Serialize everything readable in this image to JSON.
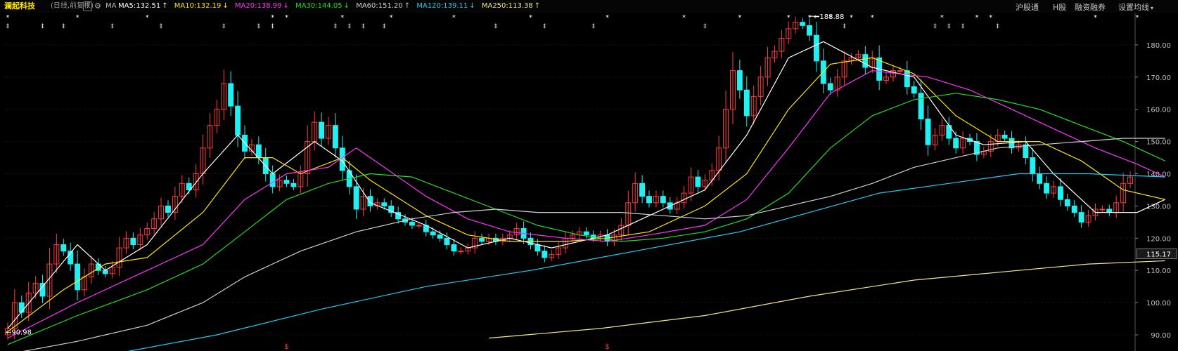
{
  "header": {
    "stock_name": "澜起科技",
    "period": "(日线,前复权)",
    "help": "?",
    "ma_label": "MA",
    "ma_items": [
      {
        "label": "MA5:132.51",
        "arrow": "↑",
        "color": "#ffffff"
      },
      {
        "label": "MA10:132.19",
        "arrow": "↓",
        "color": "#ffe600"
      },
      {
        "label": "MA20:138.99",
        "arrow": "↓",
        "color": "#ff33ff"
      },
      {
        "label": "MA30:144.05",
        "arrow": "↓",
        "color": "#22dd22"
      },
      {
        "label": "MA60:151.20",
        "arrow": "↑",
        "color": "#d0d0d0"
      },
      {
        "label": "MA120:139.11",
        "arrow": "↓",
        "color": "#22ccee"
      },
      {
        "label": "MA250:113.38",
        "arrow": "↑",
        "color": "#f0e68c"
      }
    ],
    "menu": [
      "沪股通",
      "H股",
      "融资融券",
      "设置均线"
    ]
  },
  "colors": {
    "up": "#ff3b3b",
    "down": "#22f0f0",
    "grid": "#3a1a1a",
    "axis_text": "#c0c0c0",
    "price_tag_bg": "#1a1a1a",
    "marker": "#ffffff",
    "dollar_marker": "#ff3b3b"
  },
  "chart_data": {
    "type": "candlestick",
    "ylim": [
      85,
      190
    ],
    "yticks": [
      90,
      100,
      110,
      120,
      130,
      140,
      150,
      160,
      170,
      180
    ],
    "ytick_labels": [
      "90.00",
      "100.00",
      "110.00",
      "120.00",
      "130.00",
      "140.00",
      "150.00",
      "160.00",
      "170.00",
      "180.00"
    ],
    "current_price": 115.17,
    "current_price_label": "115.17",
    "high_annotation": {
      "value": 188.88,
      "label": "188.88",
      "index": 115
    },
    "low_annotation": {
      "value": 90.98,
      "label": "90.98",
      "index": 0
    },
    "dollar_markers": [
      {
        "index": 40,
        "label": "$"
      },
      {
        "index": 86,
        "label": "$"
      }
    ],
    "star_markers_row1": [
      0,
      10,
      20,
      38,
      40,
      48,
      55,
      64,
      75,
      86,
      97,
      105,
      112,
      115,
      118,
      121,
      124,
      134,
      139,
      141,
      156,
      162
    ],
    "star_markers_row2": [
      0,
      5,
      8,
      15,
      22,
      31,
      36,
      38,
      47,
      49,
      51,
      54,
      70,
      77,
      84,
      100,
      120,
      133,
      135,
      137,
      142
    ],
    "closes": [
      92,
      100,
      97,
      103,
      106,
      102,
      112,
      118,
      116,
      112,
      104,
      108,
      112,
      110,
      109,
      111,
      117,
      120,
      118,
      121,
      123,
      126,
      130,
      128,
      133,
      137,
      135,
      140,
      148,
      155,
      160,
      168,
      161,
      152,
      147,
      149,
      145,
      140,
      136,
      138,
      137,
      136,
      140,
      150,
      156,
      151,
      155,
      148,
      141,
      136,
      129,
      133,
      130,
      131,
      130,
      128,
      126,
      125,
      124,
      124,
      122,
      121,
      120,
      118,
      116,
      116,
      117,
      120,
      119,
      120,
      119,
      120,
      121,
      123,
      120,
      118,
      116,
      114,
      115,
      117,
      120,
      121,
      122,
      121,
      120,
      121,
      119,
      121,
      124,
      131,
      137,
      133,
      131,
      133,
      131,
      129,
      131,
      134,
      139,
      136,
      138,
      141,
      148,
      160,
      172,
      166,
      158,
      164,
      170,
      176,
      178,
      182,
      185,
      187,
      186,
      183,
      175,
      168,
      166,
      170,
      175,
      176,
      177,
      173,
      176,
      169,
      170,
      172,
      172,
      167,
      165,
      157,
      149,
      152,
      155,
      151,
      148,
      151,
      150,
      146,
      147,
      150,
      152,
      151,
      148,
      149,
      145,
      140,
      137,
      134,
      136,
      132,
      130,
      128,
      125,
      127,
      129,
      129,
      128,
      131,
      137,
      139
    ],
    "series": [
      {
        "name": "MA5",
        "color": "#ffffff",
        "values": [
          [
            0,
            92
          ],
          [
            10,
            118
          ],
          [
            14,
            110
          ],
          [
            20,
            118
          ],
          [
            28,
            140
          ],
          [
            33,
            152
          ],
          [
            38,
            140
          ],
          [
            44,
            150
          ],
          [
            48,
            144
          ],
          [
            52,
            131
          ],
          [
            60,
            124
          ],
          [
            66,
            117
          ],
          [
            72,
            120
          ],
          [
            78,
            117
          ],
          [
            86,
            121
          ],
          [
            92,
            127
          ],
          [
            100,
            135
          ],
          [
            106,
            152
          ],
          [
            112,
            176
          ],
          [
            117,
            181
          ],
          [
            124,
            173
          ],
          [
            130,
            170
          ],
          [
            136,
            152
          ],
          [
            140,
            149
          ],
          [
            146,
            150
          ],
          [
            150,
            140
          ],
          [
            156,
            128
          ],
          [
            162,
            128
          ],
          [
            166,
            132
          ]
        ]
      },
      {
        "name": "MA10",
        "color": "#ffe600",
        "values": [
          [
            0,
            91
          ],
          [
            8,
            104
          ],
          [
            14,
            112
          ],
          [
            20,
            114
          ],
          [
            28,
            128
          ],
          [
            34,
            145
          ],
          [
            38,
            145
          ],
          [
            42,
            140
          ],
          [
            48,
            145
          ],
          [
            52,
            138
          ],
          [
            60,
            127
          ],
          [
            66,
            121
          ],
          [
            72,
            119
          ],
          [
            80,
            119
          ],
          [
            86,
            120
          ],
          [
            92,
            122
          ],
          [
            100,
            130
          ],
          [
            106,
            140
          ],
          [
            112,
            160
          ],
          [
            118,
            174
          ],
          [
            124,
            176
          ],
          [
            130,
            171
          ],
          [
            136,
            158
          ],
          [
            142,
            150
          ],
          [
            148,
            150
          ],
          [
            154,
            144
          ],
          [
            160,
            135
          ],
          [
            166,
            132
          ]
        ]
      },
      {
        "name": "MA20",
        "color": "#ff33ff",
        "values": [
          [
            0,
            89
          ],
          [
            10,
            100
          ],
          [
            20,
            110
          ],
          [
            28,
            118
          ],
          [
            34,
            132
          ],
          [
            40,
            140
          ],
          [
            46,
            142
          ],
          [
            50,
            148
          ],
          [
            54,
            142
          ],
          [
            60,
            133
          ],
          [
            66,
            126
          ],
          [
            72,
            122
          ],
          [
            80,
            120
          ],
          [
            86,
            119
          ],
          [
            92,
            121
          ],
          [
            100,
            124
          ],
          [
            106,
            132
          ],
          [
            112,
            148
          ],
          [
            118,
            165
          ],
          [
            124,
            172
          ],
          [
            132,
            170
          ],
          [
            138,
            166
          ],
          [
            144,
            160
          ],
          [
            150,
            154
          ],
          [
            156,
            148
          ],
          [
            162,
            143
          ],
          [
            166,
            139
          ]
        ]
      },
      {
        "name": "MA30",
        "color": "#22dd22",
        "values": [
          [
            0,
            87
          ],
          [
            10,
            96
          ],
          [
            20,
            104
          ],
          [
            28,
            112
          ],
          [
            34,
            122
          ],
          [
            40,
            132
          ],
          [
            46,
            137
          ],
          [
            52,
            140
          ],
          [
            58,
            139
          ],
          [
            64,
            134
          ],
          [
            70,
            129
          ],
          [
            76,
            124
          ],
          [
            82,
            121
          ],
          [
            88,
            119
          ],
          [
            94,
            120
          ],
          [
            100,
            122
          ],
          [
            106,
            126
          ],
          [
            112,
            134
          ],
          [
            118,
            148
          ],
          [
            124,
            158
          ],
          [
            130,
            163
          ],
          [
            136,
            165
          ],
          [
            142,
            163
          ],
          [
            148,
            160
          ],
          [
            154,
            155
          ],
          [
            160,
            150
          ],
          [
            166,
            144
          ]
        ]
      },
      {
        "name": "MA60",
        "color": "#d0d0d0",
        "values": [
          [
            0,
            84
          ],
          [
            10,
            88
          ],
          [
            20,
            93
          ],
          [
            28,
            100
          ],
          [
            34,
            108
          ],
          [
            42,
            116
          ],
          [
            50,
            122
          ],
          [
            58,
            126
          ],
          [
            64,
            128
          ],
          [
            70,
            129
          ],
          [
            76,
            128
          ],
          [
            82,
            128
          ],
          [
            88,
            128
          ],
          [
            94,
            127
          ],
          [
            100,
            126
          ],
          [
            106,
            127
          ],
          [
            112,
            130
          ],
          [
            118,
            133
          ],
          [
            124,
            137
          ],
          [
            130,
            142
          ],
          [
            136,
            145
          ],
          [
            142,
            148
          ],
          [
            148,
            149
          ],
          [
            154,
            150
          ],
          [
            160,
            151
          ],
          [
            166,
            151
          ]
        ]
      },
      {
        "name": "MA120",
        "color": "#22ccee",
        "values": [
          [
            0,
            80
          ],
          [
            15,
            84
          ],
          [
            30,
            90
          ],
          [
            45,
            98
          ],
          [
            60,
            105
          ],
          [
            75,
            110
          ],
          [
            90,
            116
          ],
          [
            105,
            122
          ],
          [
            115,
            128
          ],
          [
            125,
            134
          ],
          [
            135,
            137
          ],
          [
            145,
            140
          ],
          [
            155,
            140
          ],
          [
            166,
            139
          ]
        ]
      },
      {
        "name": "MA250",
        "color": "#f0e68c",
        "values": [
          [
            69,
            89
          ],
          [
            85,
            92
          ],
          [
            100,
            96
          ],
          [
            115,
            102
          ],
          [
            130,
            107
          ],
          [
            145,
            110
          ],
          [
            155,
            112
          ],
          [
            166,
            113
          ]
        ]
      }
    ]
  }
}
